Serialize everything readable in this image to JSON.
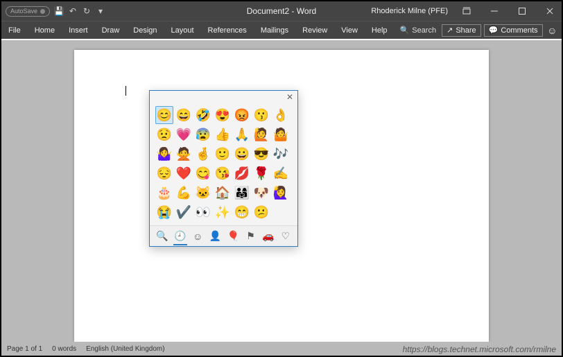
{
  "titlebar": {
    "autosave_label": "AutoSave",
    "title": "Document2 - Word",
    "user": "Rhoderick Milne (PFE)"
  },
  "ribbon": {
    "tabs": [
      "File",
      "Home",
      "Insert",
      "Draw",
      "Design",
      "Layout",
      "References",
      "Mailings",
      "Review",
      "View",
      "Help"
    ],
    "search_label": "Search",
    "share_label": "Share",
    "comments_label": "Comments"
  },
  "statusbar": {
    "page": "Page 1 of 1",
    "words": "0 words",
    "language": "English (United Kingdom)",
    "watermark": "https://blogs.technet.microsoft.com/rmilne"
  },
  "emoji": {
    "grid": [
      [
        "😊",
        "😄",
        "🤣",
        "😍",
        "😡",
        "😗",
        "👌"
      ],
      [
        "😟",
        "💗",
        "😰",
        "👍",
        "🙏",
        "🙋",
        "🤷"
      ],
      [
        "🤷‍♀️",
        "🙅",
        "🤞",
        "🙂",
        "😀",
        "😎",
        "🎶"
      ],
      [
        "😔",
        "❤️",
        "😋",
        "😘",
        "💋",
        "🌹",
        "✍️"
      ],
      [
        "🎂",
        "💪",
        "🐱",
        "🏠",
        "👨‍👩‍👧",
        "🐶",
        "🙋‍♀️"
      ],
      [
        "😭",
        "✔️",
        "👀",
        "✨",
        "😁",
        "😕",
        ""
      ]
    ],
    "selected": [
      0,
      0
    ],
    "tabs": [
      "search",
      "recent",
      "smileys",
      "people",
      "symbols",
      "flags",
      "objects",
      "favorites"
    ]
  }
}
